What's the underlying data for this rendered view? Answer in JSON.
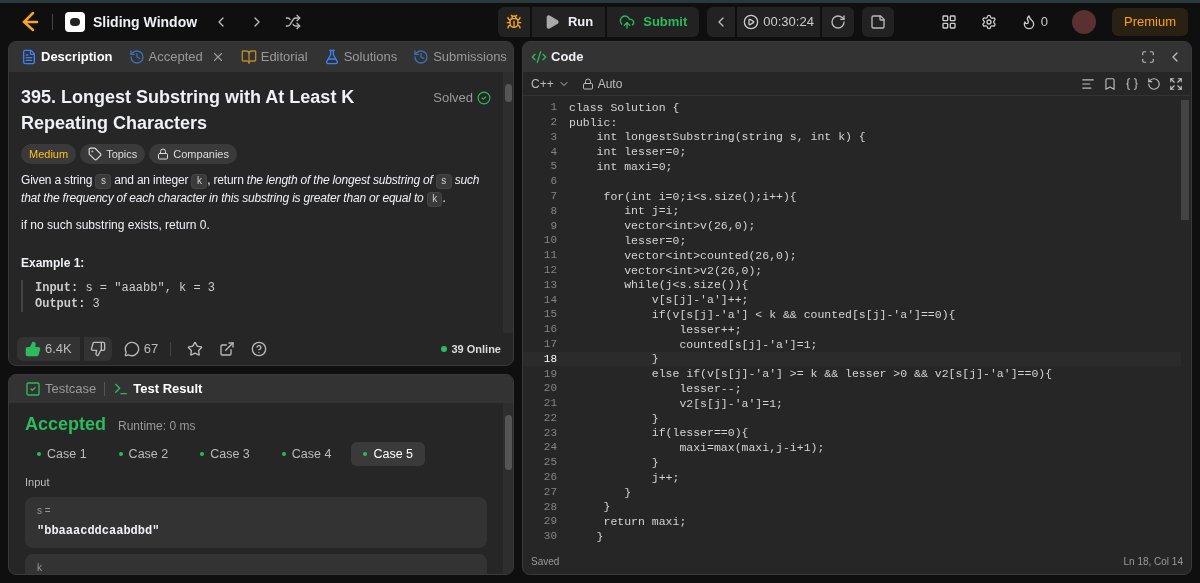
{
  "topbar": {
    "problem_list": "Sliding Window",
    "run": "Run",
    "submit": "Submit",
    "timer": "00:30:24",
    "streak": "0",
    "premium": "Premium"
  },
  "description_tabs": [
    {
      "label": "Description",
      "selected": true,
      "closable": false,
      "kind": "doc"
    },
    {
      "label": "Accepted",
      "selected": false,
      "closable": true,
      "kind": "history"
    },
    {
      "label": "Editorial",
      "selected": false,
      "closable": false,
      "kind": "book"
    },
    {
      "label": "Solutions",
      "selected": false,
      "closable": false,
      "kind": "flask"
    },
    {
      "label": "Submissions",
      "selected": false,
      "closable": false,
      "kind": "history"
    }
  ],
  "problem": {
    "title": "395. Longest Substring with At Least K Repeating Characters",
    "status": "Solved",
    "tags": [
      {
        "label": "Medium",
        "kind": "difficulty"
      },
      {
        "label": "Topics",
        "kind": "topics"
      },
      {
        "label": "Companies",
        "kind": "companies"
      }
    ],
    "statement": [
      {
        "text": "Given a string ",
        "kind": "plain"
      },
      {
        "text": "s",
        "kind": "code"
      },
      {
        "text": " and an integer ",
        "kind": "plain"
      },
      {
        "text": "k",
        "kind": "code"
      },
      {
        "text": ", return ",
        "kind": "plain"
      },
      {
        "text": "the length of the longest substring of ",
        "kind": "italic"
      },
      {
        "text": "s",
        "kind": "code"
      },
      {
        "text": " such that the frequency of each character in this substring is greater than or equal to ",
        "kind": "italic"
      },
      {
        "text": "k",
        "kind": "code"
      },
      {
        "text": ".",
        "kind": "plain"
      }
    ],
    "note": "if no such substring exists, return 0.",
    "example_title": "Example 1:",
    "example_lines": [
      "**Input:** s = \"aaabb\", k = 3",
      "**Output:** 3"
    ]
  },
  "actions": {
    "likes": "6.4K",
    "comments": "67",
    "online": "39 Online"
  },
  "test_tabs": [
    {
      "label": "Testcase",
      "selected": false,
      "kind": "check"
    },
    {
      "label": "Test Result",
      "selected": true,
      "kind": "terminal"
    }
  ],
  "result": {
    "verdict": "Accepted",
    "runtime": "Runtime: 0 ms",
    "cases": [
      {
        "label": "Case 1",
        "selected": false
      },
      {
        "label": "Case 2",
        "selected": false
      },
      {
        "label": "Case 3",
        "selected": false
      },
      {
        "label": "Case 4",
        "selected": false
      },
      {
        "label": "Case 5",
        "selected": true
      }
    ],
    "input_label": "Input",
    "inputs": [
      {
        "name": "s =",
        "value": "\"bbaaacddcaabdbd\""
      },
      {
        "name": "k"
      }
    ]
  },
  "code": {
    "title": "Code",
    "language": "C++",
    "mode": "Auto",
    "status": "Saved",
    "cursor": "Ln 18, Col 14",
    "lines": [
      {
        "n": "1",
        "text": "class Solution {",
        "current": false
      },
      {
        "n": "2",
        "text": "public:",
        "current": false
      },
      {
        "n": "3",
        "text": "    int longestSubstring(string s, int k) {",
        "current": false
      },
      {
        "n": "4",
        "text": "    int lesser=0;",
        "current": false
      },
      {
        "n": "5",
        "text": "    int maxi=0;",
        "current": false
      },
      {
        "n": "6",
        "current": false
      },
      {
        "n": "7",
        "text": "     for(int i=0;i<s.size();i++){",
        "current": false
      },
      {
        "n": "8",
        "text": "        int j=i;",
        "current": false
      },
      {
        "n": "9",
        "text": "        vector<int>v(26,0);",
        "current": false
      },
      {
        "n": "10",
        "text": "        lesser=0;",
        "current": false
      },
      {
        "n": "11",
        "text": "        vector<int>counted(26,0);",
        "current": false
      },
      {
        "n": "12",
        "text": "        vector<int>v2(26,0);",
        "current": false
      },
      {
        "n": "13",
        "text": "        while(j<s.size()){",
        "current": false
      },
      {
        "n": "14",
        "text": "            v[s[j]-'a']++;",
        "current": false
      },
      {
        "n": "15",
        "text": "            if(v[s[j]-'a'] < k && counted[s[j]-'a']==0){",
        "current": false
      },
      {
        "n": "16",
        "text": "                lesser++;",
        "current": false
      },
      {
        "n": "17",
        "text": "                counted[s[j]-'a']=1;",
        "current": false
      },
      {
        "n": "18",
        "text": "            }",
        "current": true
      },
      {
        "n": "19",
        "text": "            else if(v[s[j]-'a'] >= k && lesser >0 && v2[s[j]-'a']==0){",
        "current": false
      },
      {
        "n": "20",
        "text": "                lesser--;",
        "current": false
      },
      {
        "n": "21",
        "text": "                v2[s[j]-'a']=1;",
        "current": false
      },
      {
        "n": "22",
        "text": "            }",
        "current": false
      },
      {
        "n": "23",
        "text": "            if(lesser==0){",
        "current": false
      },
      {
        "n": "24",
        "text": "                maxi=max(maxi,j-i+1);",
        "current": false
      },
      {
        "n": "25",
        "text": "            }",
        "current": false
      },
      {
        "n": "26",
        "text": "            j++;",
        "current": false
      },
      {
        "n": "27",
        "text": "        }",
        "current": false
      },
      {
        "n": "28",
        "text": "     }",
        "current": false
      },
      {
        "n": "29",
        "text": "     return maxi;",
        "current": false
      },
      {
        "n": "30",
        "text": "    }",
        "current": false
      }
    ]
  }
}
